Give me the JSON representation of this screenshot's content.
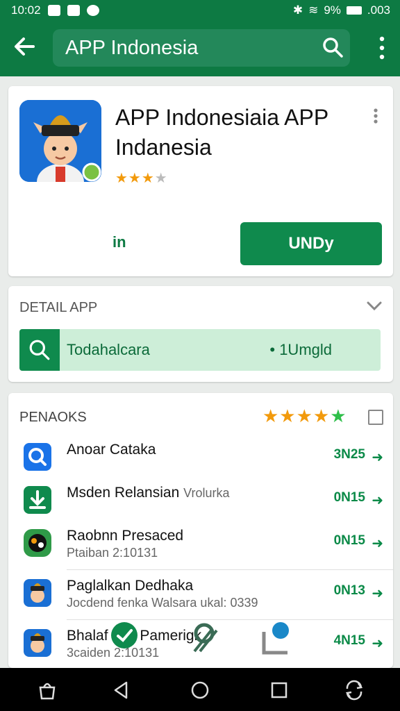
{
  "status": {
    "time": "10:02",
    "battery": "9%",
    "extra": ".003"
  },
  "appbar": {
    "search_value": "APP Indonesia"
  },
  "app": {
    "title": "APP Indonesiaia APP Indanesia",
    "rating_stars": "★★★★",
    "rating_filled": 3,
    "secondary_label": "in",
    "install_label": "UNDy"
  },
  "detail": {
    "title": "DETAIL APP",
    "row_label": "Todahalcara",
    "row_value": "• 1Umgld"
  },
  "related": {
    "title": "PENAOKS",
    "stars": "★★★★★",
    "items": [
      {
        "title": "Anoar Cataka",
        "subtitle": "",
        "size": "3N25",
        "icon": "search-app-icon",
        "color": "#1a73e8"
      },
      {
        "title": "Msden Relansian",
        "subtitle": "",
        "title_extra": "Vrolurka",
        "size": "0N15",
        "icon": "download-app-icon",
        "color": "#0f8a4d"
      },
      {
        "title": "Raobnn Presaced",
        "subtitle": "Ptaiban 2:10131",
        "size": "0N15",
        "icon": "game-app-icon",
        "color": "#2f9a48"
      },
      {
        "title": "Paglalkan Dedhaka",
        "subtitle": "Jocdend fenka Walsara ukal: 0339",
        "size": "0N13",
        "icon": "character-app-icon",
        "color": "#1a6fd4"
      },
      {
        "title": "Bhalaf",
        "title_extra": "Pamerigk",
        "subtitle": "3caiden 2:10131",
        "size": "4N15",
        "icon": "character-app-icon",
        "color": "#1a6fd4"
      }
    ]
  },
  "colors": {
    "primary": "#0d7a43",
    "button": "#0f8a4d",
    "accent_light": "#cdeed8",
    "star": "#f29a0c",
    "star_green": "#2fbf4a"
  }
}
